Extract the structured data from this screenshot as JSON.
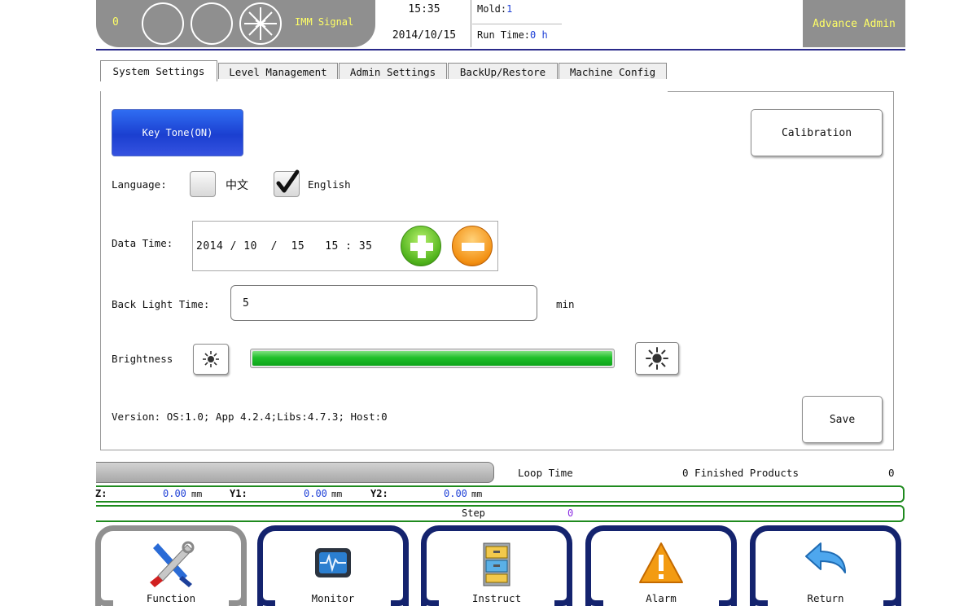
{
  "header": {
    "count": "0",
    "signal_label": "IMM Signal",
    "time": "15:35",
    "date": "2014/10/15",
    "mold_label": "Mold:",
    "mold_value": "1",
    "runtime_label": "Run Time:",
    "runtime_value": "0 h",
    "user": "Advance Admin"
  },
  "tabs": [
    {
      "label": "System Settings",
      "active": true
    },
    {
      "label": "Level Management"
    },
    {
      "label": "Admin Settings"
    },
    {
      "label": "BackUp/Restore"
    },
    {
      "label": "Machine Config"
    }
  ],
  "settings": {
    "keytone": "Key Tone(ON)",
    "calibration": "Calibration",
    "language_label": "Language:",
    "lang_cn": "中文",
    "lang_cn_checked": false,
    "lang_en": "English",
    "lang_en_checked": true,
    "datetime_label": "Data Time:",
    "datetime_value": "2014 / 10  /  15   15 : 35",
    "backlight_label": "Back Light Time:",
    "backlight_value": "5",
    "backlight_unit": "min",
    "brightness_label": "Brightness",
    "brightness_level": 1.0,
    "version": "Version: OS:1.0; App 4.2.4;Libs:4.7.3; Host:0",
    "save": "Save"
  },
  "status": {
    "loop_time_label": "Loop Time",
    "finished_label": "0 Finished Products",
    "finished_value": "0",
    "axis1_label": "Z:",
    "axis1_value": "0.00",
    "axis1_unit": "mm",
    "axis2_label": "Y1:",
    "axis2_value": "0.00",
    "axis2_unit": "mm",
    "axis3_label": "Y2:",
    "axis3_value": "0.00",
    "axis3_unit": "mm",
    "step_label": "Step",
    "step_value": "0"
  },
  "nav": [
    {
      "label": "Function",
      "icon": "tools-icon",
      "active": true
    },
    {
      "label": "Monitor",
      "icon": "monitor-icon"
    },
    {
      "label": "Instruct",
      "icon": "file-cabinet-icon"
    },
    {
      "label": "Alarm",
      "icon": "warning-icon"
    },
    {
      "label": "Return",
      "icon": "return-arrow-icon"
    }
  ],
  "colors": {
    "header_bg": "#8f8f8f",
    "header_text": "#ffff66",
    "nav_frame": "#14236e",
    "status_border": "#1e8a1e",
    "brightness_fill": "#1fbf2a",
    "keytone_bg": "#1b3fd0"
  }
}
